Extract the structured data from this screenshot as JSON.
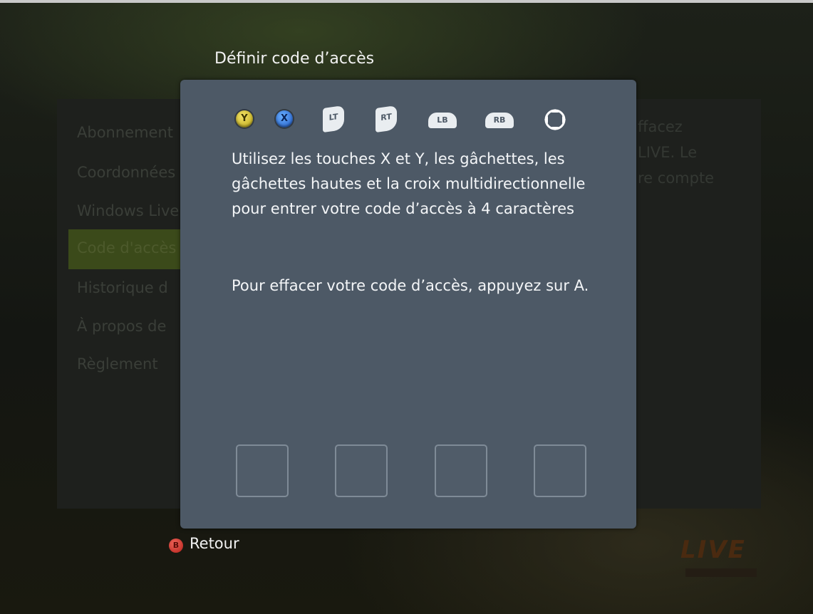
{
  "background": {
    "menu_items": [
      "Abonnement",
      "Coordonnées",
      "Windows Live",
      "Code d'accès",
      "Historique d",
      "À propos de",
      "Règlement"
    ],
    "description_lines": [
      "ffacez",
      "LIVE. Le",
      "re compte"
    ],
    "logo_text": "LIVE"
  },
  "dialog": {
    "title": "Définir code d’accès",
    "controller_icons": [
      {
        "name": "y-button-icon",
        "glyph": "Y",
        "color": "#e0cc30"
      },
      {
        "name": "x-button-icon",
        "glyph": "X",
        "color": "#2f7be6"
      },
      {
        "name": "lt-trigger-icon",
        "glyph": "LT"
      },
      {
        "name": "rt-trigger-icon",
        "glyph": "RT"
      },
      {
        "name": "lb-bumper-icon",
        "glyph": "LB"
      },
      {
        "name": "rb-bumper-icon",
        "glyph": "RB"
      },
      {
        "name": "dpad-icon",
        "glyph": ""
      }
    ],
    "instructions": "Utilisez les touches X et Y, les gâchettes, les gâchettes hautes et la croix multidirectionnelle pour entrer votre code d’accès à 4 caractères",
    "clear_hint": "Pour effacer votre code d’accès, appuyez sur A.",
    "code_slots": [
      "",
      "",
      "",
      ""
    ]
  },
  "footer": {
    "back_button_glyph": "B",
    "back_label": "Retour",
    "back_color": "#d83a2e"
  }
}
